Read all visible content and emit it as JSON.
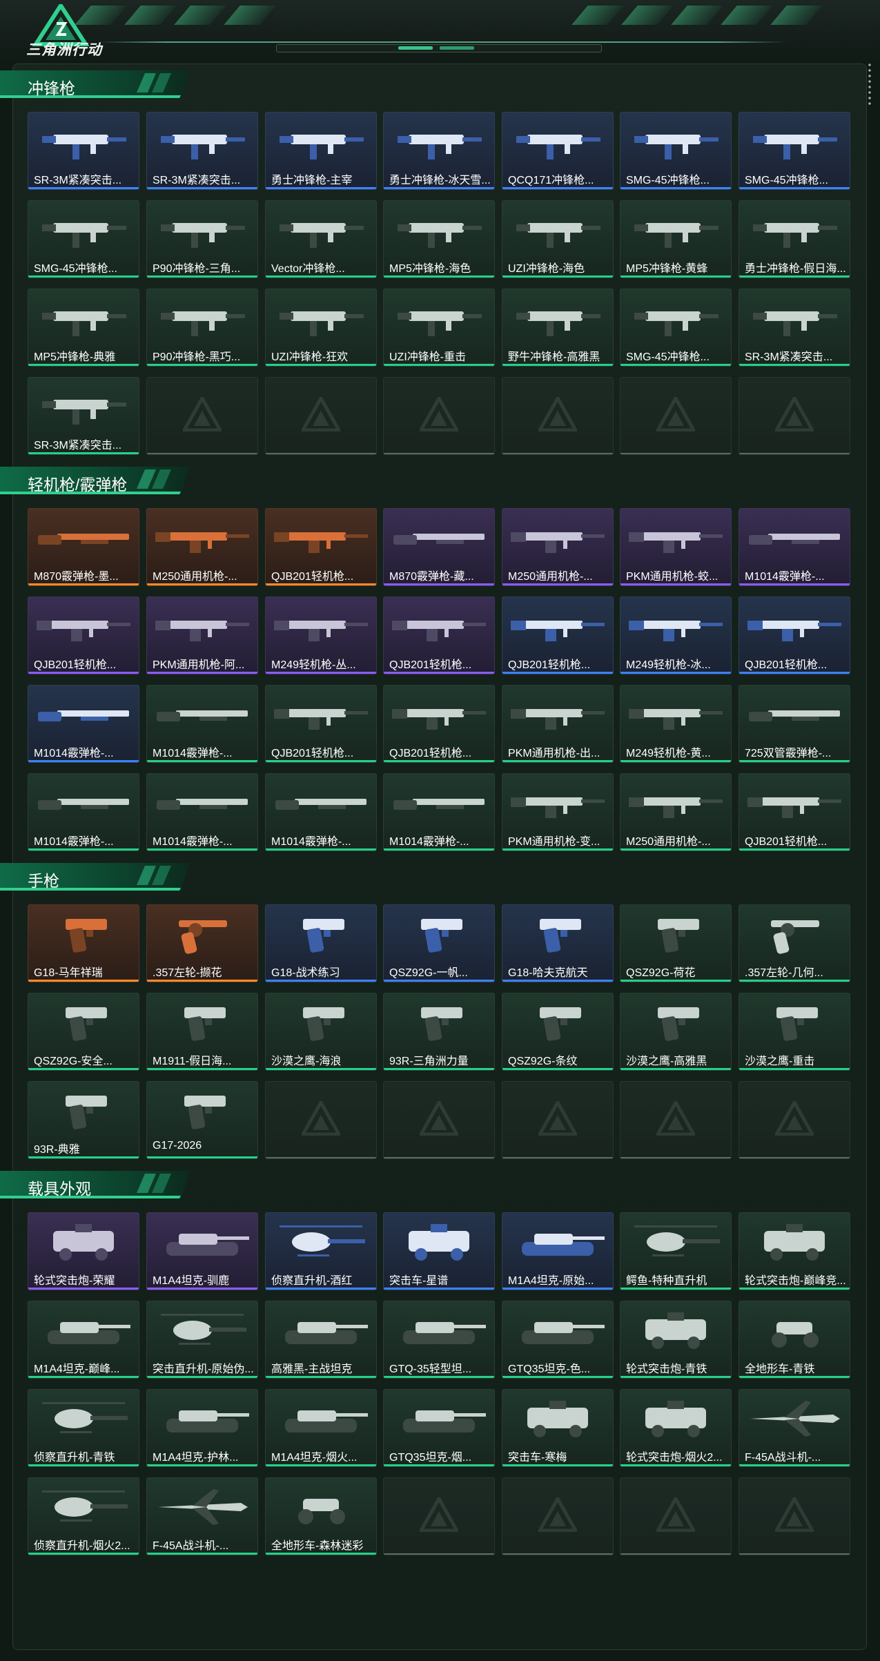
{
  "header": {
    "logo_text": "三角洲行动"
  },
  "sections": [
    {
      "title": "冲锋枪",
      "rows": [
        [
          {
            "label": "SR-3M紧凑突击...",
            "rarity": "blue",
            "icon": "smg-icon"
          },
          {
            "label": "SR-3M紧凑突击...",
            "rarity": "blue",
            "icon": "smg-icon"
          },
          {
            "label": "勇士冲锋枪-主宰",
            "rarity": "blue",
            "icon": "smg-icon"
          },
          {
            "label": "勇士冲锋枪-冰天雪...",
            "rarity": "blue",
            "icon": "smg-icon"
          },
          {
            "label": "QCQ171冲锋枪...",
            "rarity": "blue",
            "icon": "smg-icon"
          },
          {
            "label": "SMG-45冲锋枪...",
            "rarity": "blue",
            "icon": "smg-icon"
          },
          {
            "label": "SMG-45冲锋枪...",
            "rarity": "blue",
            "icon": "smg-icon"
          }
        ],
        [
          {
            "label": "SMG-45冲锋枪...",
            "rarity": "green",
            "icon": "smg-icon"
          },
          {
            "label": "P90冲锋枪-三角...",
            "rarity": "green",
            "icon": "smg-icon"
          },
          {
            "label": "Vector冲锋枪...",
            "rarity": "green",
            "icon": "smg-icon"
          },
          {
            "label": "MP5冲锋枪-海色",
            "rarity": "green",
            "icon": "smg-icon"
          },
          {
            "label": "UZI冲锋枪-海色",
            "rarity": "green",
            "icon": "smg-icon"
          },
          {
            "label": "MP5冲锋枪-黄蜂",
            "rarity": "green",
            "icon": "smg-icon"
          },
          {
            "label": "勇士冲锋枪-假日海...",
            "rarity": "green",
            "icon": "smg-icon"
          }
        ],
        [
          {
            "label": "MP5冲锋枪-典雅",
            "rarity": "green",
            "icon": "smg-icon"
          },
          {
            "label": "P90冲锋枪-黑巧...",
            "rarity": "green",
            "icon": "smg-icon"
          },
          {
            "label": "UZI冲锋枪-狂欢",
            "rarity": "green",
            "icon": "smg-icon"
          },
          {
            "label": "UZI冲锋枪-重击",
            "rarity": "green",
            "icon": "smg-icon"
          },
          {
            "label": "野牛冲锋枪-高雅黑",
            "rarity": "green",
            "icon": "smg-icon"
          },
          {
            "label": "SMG-45冲锋枪...",
            "rarity": "green",
            "icon": "smg-icon"
          },
          {
            "label": "SR-3M紧凑突击...",
            "rarity": "green",
            "icon": "smg-icon"
          }
        ],
        [
          {
            "label": "SR-3M紧凑突击...",
            "rarity": "green",
            "icon": "smg-icon"
          },
          {
            "label": "",
            "rarity": "empty"
          },
          {
            "label": "",
            "rarity": "empty"
          },
          {
            "label": "",
            "rarity": "empty"
          },
          {
            "label": "",
            "rarity": "empty"
          },
          {
            "label": "",
            "rarity": "empty"
          },
          {
            "label": "",
            "rarity": "empty"
          }
        ]
      ]
    },
    {
      "title": "轻机枪/霰弹枪",
      "rows": [
        [
          {
            "label": "M870霰弹枪-墨...",
            "rarity": "orange",
            "icon": "shotgun-icon"
          },
          {
            "label": "M250通用机枪-...",
            "rarity": "orange",
            "icon": "lmg-icon"
          },
          {
            "label": "QJB201轻机枪...",
            "rarity": "orange",
            "icon": "lmg-icon"
          },
          {
            "label": "M870霰弹枪-藏...",
            "rarity": "purple",
            "icon": "shotgun-icon"
          },
          {
            "label": "M250通用机枪-...",
            "rarity": "purple",
            "icon": "lmg-icon"
          },
          {
            "label": "PKM通用机枪-蛟...",
            "rarity": "purple",
            "icon": "lmg-icon"
          },
          {
            "label": "M1014霰弹枪-...",
            "rarity": "purple",
            "icon": "shotgun-icon"
          }
        ],
        [
          {
            "label": "QJB201轻机枪...",
            "rarity": "purple",
            "icon": "lmg-icon"
          },
          {
            "label": "PKM通用机枪-阿...",
            "rarity": "purple",
            "icon": "lmg-icon"
          },
          {
            "label": "M249轻机枪-丛...",
            "rarity": "purple",
            "icon": "lmg-icon"
          },
          {
            "label": "QJB201轻机枪...",
            "rarity": "purple",
            "icon": "lmg-icon"
          },
          {
            "label": "QJB201轻机枪...",
            "rarity": "blue",
            "icon": "lmg-icon"
          },
          {
            "label": "M249轻机枪-冰...",
            "rarity": "blue",
            "icon": "lmg-icon"
          },
          {
            "label": "QJB201轻机枪...",
            "rarity": "blue",
            "icon": "lmg-icon"
          }
        ],
        [
          {
            "label": "M1014霰弹枪-...",
            "rarity": "blue",
            "icon": "shotgun-icon"
          },
          {
            "label": "M1014霰弹枪-...",
            "rarity": "green",
            "icon": "shotgun-icon"
          },
          {
            "label": "QJB201轻机枪...",
            "rarity": "green",
            "icon": "lmg-icon"
          },
          {
            "label": "QJB201轻机枪...",
            "rarity": "green",
            "icon": "lmg-icon"
          },
          {
            "label": "PKM通用机枪-出...",
            "rarity": "green",
            "icon": "lmg-icon"
          },
          {
            "label": "M249轻机枪-黄...",
            "rarity": "green",
            "icon": "lmg-icon"
          },
          {
            "label": "725双管霰弹枪-...",
            "rarity": "green",
            "icon": "shotgun-icon"
          }
        ],
        [
          {
            "label": "M1014霰弹枪-...",
            "rarity": "green",
            "icon": "shotgun-icon"
          },
          {
            "label": "M1014霰弹枪-...",
            "rarity": "green",
            "icon": "shotgun-icon"
          },
          {
            "label": "M1014霰弹枪-...",
            "rarity": "green",
            "icon": "shotgun-icon"
          },
          {
            "label": "M1014霰弹枪-...",
            "rarity": "green",
            "icon": "shotgun-icon"
          },
          {
            "label": "PKM通用机枪-变...",
            "rarity": "green",
            "icon": "lmg-icon"
          },
          {
            "label": "M250通用机枪-...",
            "rarity": "green",
            "icon": "lmg-icon"
          },
          {
            "label": "QJB201轻机枪...",
            "rarity": "green",
            "icon": "lmg-icon"
          }
        ]
      ]
    },
    {
      "title": "手枪",
      "rows": [
        [
          {
            "label": "G18-马年祥瑞",
            "rarity": "orange",
            "icon": "pistol-icon"
          },
          {
            "label": ".357左轮-撷花",
            "rarity": "orange",
            "icon": "revolver-icon"
          },
          {
            "label": "G18-战术练习",
            "rarity": "blue",
            "icon": "pistol-icon"
          },
          {
            "label": "QSZ92G-一帆...",
            "rarity": "blue",
            "icon": "pistol-icon"
          },
          {
            "label": "G18-哈夫克航天",
            "rarity": "blue",
            "icon": "pistol-icon"
          },
          {
            "label": "QSZ92G-荷花",
            "rarity": "green",
            "icon": "pistol-icon"
          },
          {
            "label": ".357左轮-几何...",
            "rarity": "green",
            "icon": "revolver-icon"
          }
        ],
        [
          {
            "label": "QSZ92G-安全...",
            "rarity": "green",
            "icon": "pistol-icon"
          },
          {
            "label": "M1911-假日海...",
            "rarity": "green",
            "icon": "pistol-icon"
          },
          {
            "label": "沙漠之鹰-海浪",
            "rarity": "green",
            "icon": "pistol-icon"
          },
          {
            "label": "93R-三角洲力量",
            "rarity": "green",
            "icon": "pistol-icon"
          },
          {
            "label": "QSZ92G-条纹",
            "rarity": "green",
            "icon": "pistol-icon"
          },
          {
            "label": "沙漠之鹰-高雅黑",
            "rarity": "green",
            "icon": "pistol-icon"
          },
          {
            "label": "沙漠之鹰-重击",
            "rarity": "green",
            "icon": "pistol-icon"
          }
        ],
        [
          {
            "label": "93R-典雅",
            "rarity": "green",
            "icon": "pistol-icon"
          },
          {
            "label": "G17-2026",
            "rarity": "green",
            "icon": "pistol-icon"
          },
          {
            "label": "",
            "rarity": "empty"
          },
          {
            "label": "",
            "rarity": "empty"
          },
          {
            "label": "",
            "rarity": "empty"
          },
          {
            "label": "",
            "rarity": "empty"
          },
          {
            "label": "",
            "rarity": "empty"
          }
        ]
      ]
    },
    {
      "title": "载具外观",
      "rows": [
        [
          {
            "label": "轮式突击炮-荣耀",
            "rarity": "purple",
            "icon": "armored-car-icon"
          },
          {
            "label": "M1A4坦克-驯鹿",
            "rarity": "purple",
            "icon": "tank-icon"
          },
          {
            "label": "侦察直升机-酒红",
            "rarity": "blue",
            "icon": "helicopter-icon"
          },
          {
            "label": "突击车-星谱",
            "rarity": "blue",
            "icon": "armored-car-icon"
          },
          {
            "label": "M1A4坦克-原始...",
            "rarity": "blue",
            "icon": "tank-icon"
          },
          {
            "label": "鳄鱼-特种直升机",
            "rarity": "green",
            "icon": "helicopter-icon"
          },
          {
            "label": "轮式突击炮-巅峰竞...",
            "rarity": "green",
            "icon": "armored-car-icon"
          }
        ],
        [
          {
            "label": "M1A4坦克-巅峰...",
            "rarity": "green",
            "icon": "tank-icon"
          },
          {
            "label": "突击直升机-原始伪...",
            "rarity": "green",
            "icon": "helicopter-icon"
          },
          {
            "label": "高雅黑-主战坦克",
            "rarity": "green",
            "icon": "tank-icon"
          },
          {
            "label": "GTQ-35轻型坦...",
            "rarity": "green",
            "icon": "tank-icon"
          },
          {
            "label": "GTQ35坦克-色...",
            "rarity": "green",
            "icon": "tank-icon"
          },
          {
            "label": "轮式突击炮-青铁",
            "rarity": "green",
            "icon": "armored-car-icon"
          },
          {
            "label": "全地形车-青铁",
            "rarity": "green",
            "icon": "atv-icon"
          }
        ],
        [
          {
            "label": "侦察直升机-青铁",
            "rarity": "green",
            "icon": "helicopter-icon"
          },
          {
            "label": "M1A4坦克-护林...",
            "rarity": "green",
            "icon": "tank-icon"
          },
          {
            "label": "M1A4坦克-烟火...",
            "rarity": "green",
            "icon": "tank-icon"
          },
          {
            "label": "GTQ35坦克-烟...",
            "rarity": "green",
            "icon": "tank-icon"
          },
          {
            "label": "突击车-寒梅",
            "rarity": "green",
            "icon": "armored-car-icon"
          },
          {
            "label": "轮式突击炮-烟火2...",
            "rarity": "green",
            "icon": "armored-car-icon"
          },
          {
            "label": "F-45A战斗机-...",
            "rarity": "green",
            "icon": "jet-icon"
          }
        ],
        [
          {
            "label": "侦察直升机-烟火2...",
            "rarity": "green",
            "icon": "helicopter-icon"
          },
          {
            "label": "F-45A战斗机-...",
            "rarity": "green",
            "icon": "jet-icon"
          },
          {
            "label": "全地形车-森林迷彩",
            "rarity": "green",
            "icon": "atv-icon"
          },
          {
            "label": "",
            "rarity": "empty"
          },
          {
            "label": "",
            "rarity": "empty"
          },
          {
            "label": "",
            "rarity": "empty"
          },
          {
            "label": "",
            "rarity": "empty"
          }
        ]
      ]
    }
  ],
  "colors": {
    "background": "#101a15",
    "accent_green": "#25d089",
    "rarity_orange": "#ff8a2b",
    "rarity_purple": "#8b5cf6",
    "rarity_blue": "#3b82f6",
    "rarity_green": "#25d089"
  }
}
